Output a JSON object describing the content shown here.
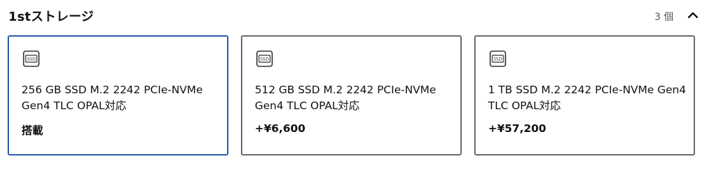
{
  "section": {
    "title": "1stストレージ",
    "count": "3 個",
    "collapse_icon": "chevron-up-icon"
  },
  "options": [
    {
      "icon": "ssd-icon",
      "icon_text": "SSD",
      "name": "256 GB SSD M.2 2242 PCIe-NVMe Gen4 TLC OPAL対応",
      "price": "搭載",
      "selected": true
    },
    {
      "icon": "ssd-icon",
      "icon_text": "SSD",
      "name": "512 GB SSD M.2 2242 PCIe-NVMe Gen4 TLC OPAL対応",
      "price": "+¥6,600",
      "selected": false
    },
    {
      "icon": "ssd-icon",
      "icon_text": "SSD",
      "name": "1 TB SSD M.2 2242 PCIe-NVMe Gen4 TLC OPAL対応",
      "price": "+¥57,200",
      "selected": false
    }
  ],
  "colors": {
    "selected_border": "#2a5aa8",
    "default_border": "#6b6b6b",
    "text": "#111111"
  }
}
